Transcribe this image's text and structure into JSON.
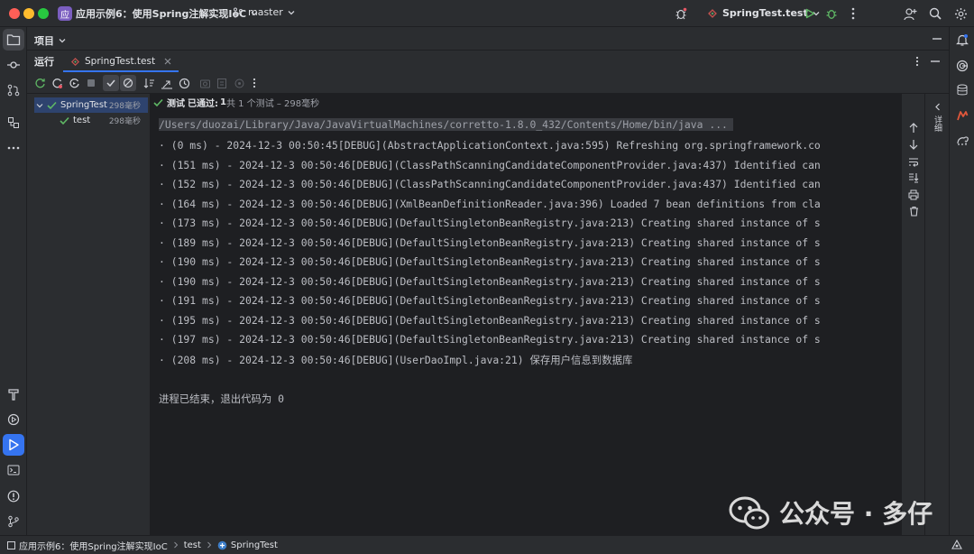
{
  "title_bar": {
    "project_badge": "应",
    "project_name": "应用示例6：使用Spring注解实现IoC",
    "branch": "master",
    "run_config": "SpringTest.test"
  },
  "left_rail": {
    "top_icons": [
      "folder-icon",
      "commit-icon",
      "pull-request-icon",
      "structure-icon",
      "more-icon"
    ],
    "bottom_icons": [
      "hammer-icon",
      "services-icon",
      "run-icon",
      "terminal-icon",
      "problems-icon",
      "git-icon"
    ]
  },
  "right_rail": {
    "icons": [
      "notifications-icon",
      "ai-assistant-icon",
      "database-icon",
      "maven-icon",
      "gradle-icon"
    ]
  },
  "project_header": {
    "label": "项目"
  },
  "run_panel": {
    "label": "运行",
    "tab_label": "SpringTest.test",
    "toolbar_icons": [
      "rerun-icon",
      "rerun-failed-icon",
      "toggle-auto-test-icon",
      "stop-icon",
      "show-passed-icon",
      "show-ignored-icon",
      "sort-alpha-icon",
      "sort-duration-icon",
      "history-icon",
      "import-icon",
      "export-icon",
      "test-settings-icon",
      "more-icon"
    ],
    "status": {
      "label": "测试",
      "passed_prefix": "已通过:",
      "passed_count": "1",
      "rest": "共 1 个测试 – 298毫秒"
    },
    "tree": [
      {
        "label": "SpringTest",
        "time": "298毫秒",
        "level": 0,
        "selected": true
      },
      {
        "label": "test",
        "time": "298毫秒",
        "level": 1,
        "selected": false
      }
    ],
    "console_lines": [
      "/Users/duozai/Library/Java/JavaVirtualMachines/corretto-1.8.0_432/Contents/Home/bin/java ...",
      "· (0 ms) - 2024-12-3 00:50:45[DEBUG](AbstractApplicationContext.java:595) Refreshing org.springframework.co",
      "· (151 ms) - 2024-12-3 00:50:46[DEBUG](ClassPathScanningCandidateComponentProvider.java:437) Identified can",
      "· (152 ms) - 2024-12-3 00:50:46[DEBUG](ClassPathScanningCandidateComponentProvider.java:437) Identified can",
      "· (164 ms) - 2024-12-3 00:50:46[DEBUG](XmlBeanDefinitionReader.java:396) Loaded 7 bean definitions from cla",
      "· (173 ms) - 2024-12-3 00:50:46[DEBUG](DefaultSingletonBeanRegistry.java:213) Creating shared instance of s",
      "· (189 ms) - 2024-12-3 00:50:46[DEBUG](DefaultSingletonBeanRegistry.java:213) Creating shared instance of s",
      "· (190 ms) - 2024-12-3 00:50:46[DEBUG](DefaultSingletonBeanRegistry.java:213) Creating shared instance of s",
      "· (190 ms) - 2024-12-3 00:50:46[DEBUG](DefaultSingletonBeanRegistry.java:213) Creating shared instance of s",
      "· (191 ms) - 2024-12-3 00:50:46[DEBUG](DefaultSingletonBeanRegistry.java:213) Creating shared instance of s",
      "· (195 ms) - 2024-12-3 00:50:46[DEBUG](DefaultSingletonBeanRegistry.java:213) Creating shared instance of s",
      "· (197 ms) - 2024-12-3 00:50:46[DEBUG](DefaultSingletonBeanRegistry.java:213) Creating shared instance of s",
      "· (208 ms) - 2024-12-3 00:50:46[DEBUG](UserDaoImpl.java:21) 保存用户信息到数据库",
      "",
      "进程已结束，退出代码为 0"
    ],
    "console_side_icons": [
      "scroll-up-icon",
      "scroll-down-icon",
      "soft-wrap-icon",
      "scroll-to-end-icon",
      "print-icon",
      "clear-icon"
    ],
    "side_panel_label": "详细"
  },
  "watermark": {
    "text": "公众号 · 多仔"
  },
  "status_bar": {
    "crumbs": [
      "应用示例6：使用Spring注解实现IoC",
      "test",
      "SpringTest"
    ]
  },
  "colors": {
    "accent": "#3574f0",
    "selected": "#2e436e",
    "passed": "#5fb865",
    "bg_main": "#1e1f22",
    "bg_panel": "#2b2d30"
  }
}
